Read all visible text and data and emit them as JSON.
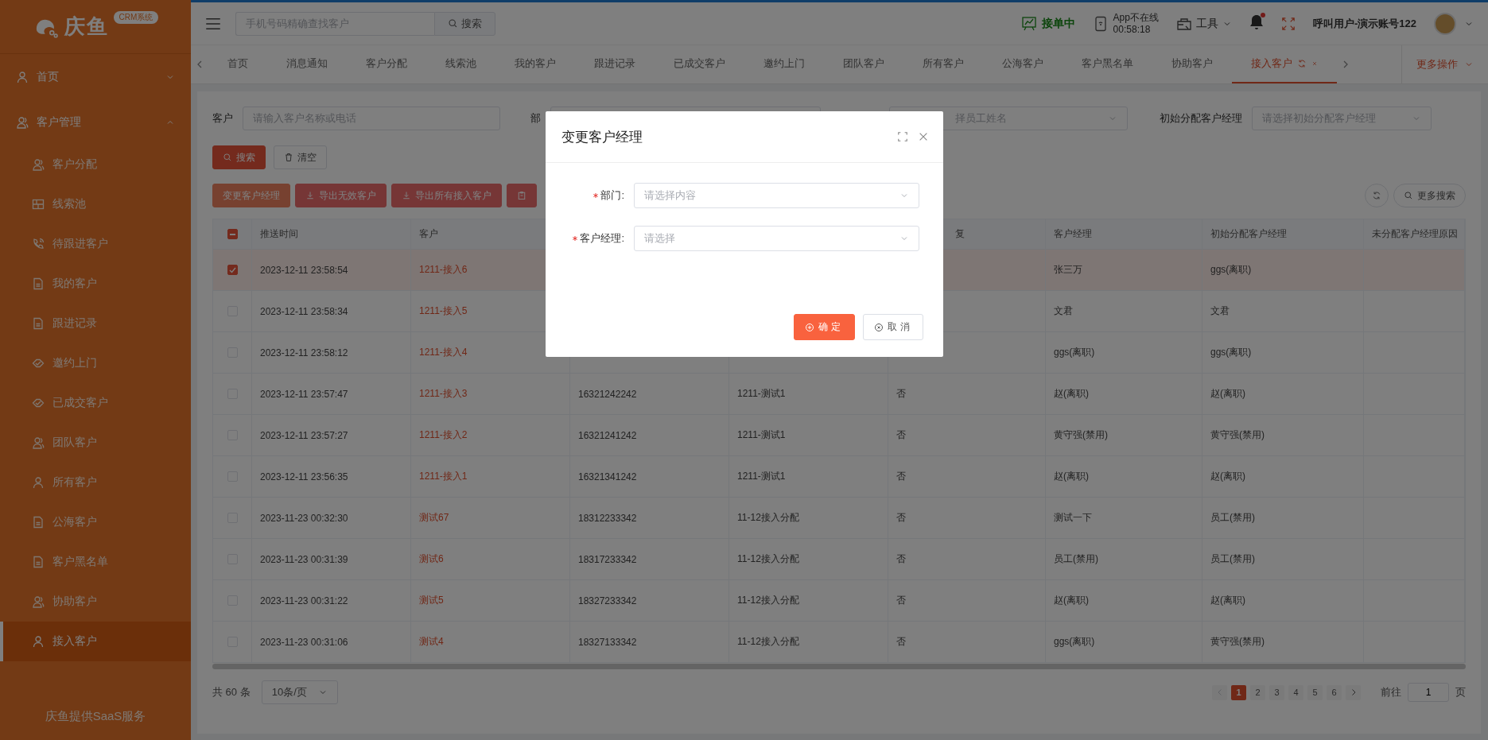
{
  "sidebar": {
    "logo": {
      "name": "庆鱼",
      "badge": "CRM系统"
    },
    "items": [
      {
        "label": "首页",
        "kind": "person",
        "expanded": false
      },
      {
        "label": "客户管理",
        "kind": "people",
        "expanded": true,
        "children": [
          {
            "label": "客户分配",
            "kind": "people",
            "selected": false
          },
          {
            "label": "线索池",
            "kind": "grid",
            "selected": false
          },
          {
            "label": "待跟进客户",
            "kind": "phone",
            "selected": false
          },
          {
            "label": "我的客户",
            "kind": "doc",
            "selected": false
          },
          {
            "label": "跟进记录",
            "kind": "doc",
            "selected": false
          },
          {
            "label": "邀约上门",
            "kind": "tag",
            "selected": false
          },
          {
            "label": "已成交客户",
            "kind": "tag",
            "selected": false
          },
          {
            "label": "团队客户",
            "kind": "people",
            "selected": false
          },
          {
            "label": "所有客户",
            "kind": "person",
            "selected": false
          },
          {
            "label": "公海客户",
            "kind": "doc",
            "selected": false
          },
          {
            "label": "客户黑名单",
            "kind": "doc",
            "selected": false
          },
          {
            "label": "协助客户",
            "kind": "people",
            "selected": false
          },
          {
            "label": "接入客户",
            "kind": "person",
            "selected": true
          }
        ]
      }
    ],
    "footer": "庆鱼提供SaaS服务"
  },
  "header": {
    "search": {
      "placeholder": "手机号码精确查找客户",
      "button": "搜索"
    },
    "status": "接单中",
    "app_status": "App不在线",
    "app_time": "00:58:18",
    "tools": "工具",
    "notifications_unread": true,
    "user": "呼叫用户-演示账号122"
  },
  "tabs": {
    "items": [
      {
        "label": "首页",
        "selected": false
      },
      {
        "label": "消息通知",
        "selected": false
      },
      {
        "label": "客户分配",
        "selected": false
      },
      {
        "label": "线索池",
        "selected": false
      },
      {
        "label": "我的客户",
        "selected": false
      },
      {
        "label": "跟进记录",
        "selected": false
      },
      {
        "label": "已成交客户",
        "selected": false
      },
      {
        "label": "邀约上门",
        "selected": false
      },
      {
        "label": "团队客户",
        "selected": false
      },
      {
        "label": "所有客户",
        "selected": false
      },
      {
        "label": "公海客户",
        "selected": false
      },
      {
        "label": "客户黑名单",
        "selected": false
      },
      {
        "label": "协助客户",
        "selected": false
      },
      {
        "label": "接入客户",
        "selected": true
      }
    ],
    "more": "更多操作"
  },
  "filters": [
    {
      "label": "客户",
      "placeholder": "请输入客户名称或电话"
    },
    {
      "label": "部"
    },
    {
      "placeholder": "择员工姓名"
    },
    {
      "label": "初始分配客户经理",
      "placeholder": "请选择初始分配客户经理"
    }
  ],
  "search_buttons": [
    {
      "label": "搜索",
      "kind": "primary"
    },
    {
      "label": "清空",
      "kind": "plain"
    }
  ],
  "actions": [
    {
      "label": "变更客户经理",
      "kind": "plain"
    },
    {
      "label": "导出无效客户",
      "kind": "download"
    },
    {
      "label": "导出所有接入客户",
      "kind": "download"
    },
    {
      "kind": "clip"
    }
  ],
  "more_search": "更多搜索",
  "table": {
    "all_indeterminate": true,
    "columns": [
      {
        "label": "推送时间"
      },
      {
        "label": "客户"
      },
      {},
      {},
      {
        "label": "复"
      },
      {
        "label": "客户经理"
      },
      {
        "label": "初始分配客户经理"
      },
      {
        "label": "未分配客户经理原因"
      }
    ],
    "rows": [
      {
        "selected": true,
        "time": "2023-12-11 23:58:54",
        "customer": "1211-接入6",
        "manager": "张三万",
        "initial_manager": "ggs(离职)"
      },
      {
        "selected": false,
        "time": "2023-12-11 23:58:34",
        "customer": "1211-接入5",
        "manager": "文君",
        "initial_manager": "文君"
      },
      {
        "selected": false,
        "time": "2023-12-11 23:58:12",
        "customer": "1211-接入4",
        "manager": "ggs(离职)",
        "initial_manager": "ggs(离职)"
      },
      {
        "selected": false,
        "time": "2023-12-11 23:57:47",
        "customer": "1211-接入3",
        "phone": "16321242242",
        "column_4": "1211-测试1",
        "column_5": "否",
        "manager": "赵(离职)",
        "initial_manager": "赵(离职)"
      },
      {
        "selected": false,
        "time": "2023-12-11 23:57:27",
        "customer": "1211-接入2",
        "phone": "16321241242",
        "column_4": "1211-测试1",
        "column_5": "否",
        "manager": "黄守强(禁用)",
        "initial_manager": "黄守强(禁用)"
      },
      {
        "selected": false,
        "time": "2023-12-11 23:56:35",
        "customer": "1211-接入1",
        "phone": "16321341242",
        "column_4": "1211-测试1",
        "column_5": "否",
        "manager": "赵(离职)",
        "initial_manager": "赵(离职)"
      },
      {
        "selected": false,
        "time": "2023-11-23 00:32:30",
        "customer": "测试67",
        "phone": "18312233342",
        "column_4": "11-12接入分配",
        "column_5": "否",
        "manager": "测试一下",
        "initial_manager": "员工(禁用)"
      },
      {
        "selected": false,
        "time": "2023-11-23 00:31:39",
        "customer": "测试6",
        "phone": "18317233342",
        "column_4": "11-12接入分配",
        "column_5": "否",
        "manager": "员工(禁用)",
        "initial_manager": "员工(禁用)"
      },
      {
        "selected": false,
        "time": "2023-11-23 00:31:22",
        "customer": "测试5",
        "phone": "18327233342",
        "column_4": "11-12接入分配",
        "column_5": "否",
        "manager": "赵(离职)",
        "initial_manager": "赵(离职)"
      },
      {
        "selected": false,
        "time": "2023-11-23 00:31:06",
        "customer": "测试4",
        "phone": "18327133342",
        "column_4": "11-12接入分配",
        "column_5": "否",
        "manager": "ggs(离职)",
        "initial_manager": "黄守强(禁用)"
      }
    ]
  },
  "pagination": {
    "total": "共 60 条",
    "page_size": "10条/页",
    "pages": [
      {
        "label": "1",
        "selected": true
      },
      {
        "label": "2",
        "selected": false
      },
      {
        "label": "3",
        "selected": false
      },
      {
        "label": "4",
        "selected": false
      },
      {
        "label": "5",
        "selected": false
      },
      {
        "label": "6",
        "selected": false
      }
    ],
    "goto_label": "前往",
    "goto_value": "1",
    "goto_suffix": "页"
  },
  "dialog": {
    "title": "变更客户经理",
    "fields": [
      {
        "label": "部门:",
        "placeholder": "请选择内容",
        "required": true
      },
      {
        "label": "客户经理:",
        "placeholder": "请选择",
        "required": true
      }
    ],
    "buttons": [
      {
        "label": "确定",
        "kind": "primary"
      },
      {
        "label": "取消",
        "kind": "cancel"
      }
    ]
  }
}
